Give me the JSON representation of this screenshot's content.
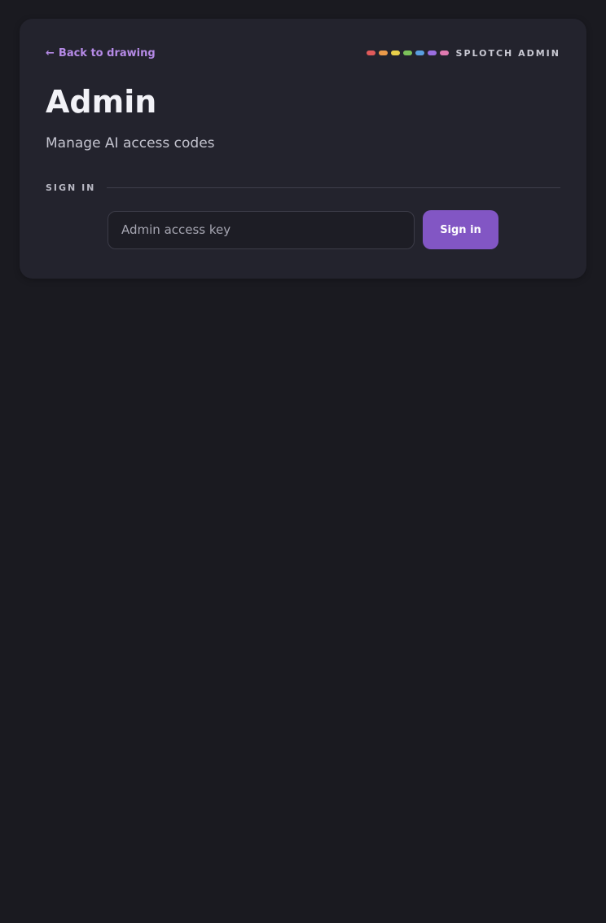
{
  "header": {
    "back_label": "Back to drawing",
    "back_arrow": "←",
    "brand_text": "SPLOTCH ADMIN",
    "brand_dot_colors": [
      "#e05a5a",
      "#eb9a4a",
      "#e8cf4a",
      "#7cc25a",
      "#5a9fe0",
      "#9a6ee0",
      "#e07ab0"
    ]
  },
  "main": {
    "title": "Admin",
    "subtitle": "Manage AI access codes"
  },
  "signin": {
    "section_label": "SIGN IN",
    "key_placeholder": "Admin access key",
    "key_value": "",
    "button_label": "Sign in"
  },
  "colors": {
    "background": "#1a1a20",
    "card": "#23232d",
    "accent": "#8256c4",
    "link": "#b58ae6"
  }
}
